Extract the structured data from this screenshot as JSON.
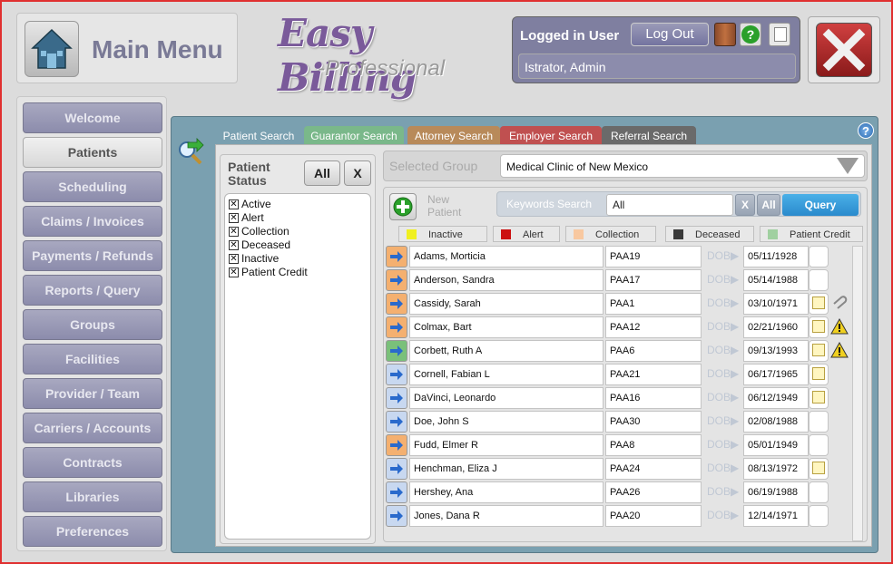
{
  "header": {
    "main_menu_label": "Main Menu",
    "logo_text": "Easy Billing",
    "logo_subtext": "-Professional",
    "logged_in_label": "Logged in User",
    "logout_label": "Log Out",
    "user_name": "Istrator, Admin"
  },
  "sidebar": {
    "items": [
      {
        "label": "Welcome"
      },
      {
        "label": "Patients"
      },
      {
        "label": "Scheduling"
      },
      {
        "label": "Claims / Invoices"
      },
      {
        "label": "Payments / Refunds"
      },
      {
        "label": "Reports / Query"
      },
      {
        "label": "Groups"
      },
      {
        "label": "Facilities"
      },
      {
        "label": "Provider / Team"
      },
      {
        "label": "Carriers / Accounts"
      },
      {
        "label": "Contracts"
      },
      {
        "label": "Libraries"
      },
      {
        "label": "Preferences"
      }
    ],
    "active": "Patients"
  },
  "tabs": [
    {
      "label": "Patient Search",
      "color": "#7aa0b0"
    },
    {
      "label": "Guarantor Search",
      "color": "#7ab88a"
    },
    {
      "label": "Attorney Search",
      "color": "#b88a5a"
    },
    {
      "label": "Employer Search",
      "color": "#c05050"
    },
    {
      "label": "Referral Search",
      "color": "#6a6a6a"
    }
  ],
  "status": {
    "title_line1": "Patient",
    "title_line2": "Status",
    "all_label": "All",
    "x_label": "X",
    "items": [
      "Active",
      "Alert",
      "Collection",
      "Deceased",
      "Inactive",
      "Patient Credit"
    ]
  },
  "group": {
    "label": "Selected Group",
    "value": "Medical Clinic of New Mexico"
  },
  "search": {
    "new_patient_line1": "New",
    "new_patient_line2": "Patient",
    "keywords_label": "Keywords Search",
    "keywords_value": "All",
    "x_label": "X",
    "all_label": "All",
    "query_label": "Query"
  },
  "legend": [
    {
      "label": "Inactive",
      "color": "#f0f020"
    },
    {
      "label": "Alert",
      "color": "#cc1010"
    },
    {
      "label": "Collection",
      "color": "#f8c8a0"
    },
    {
      "label": "Deceased",
      "color": "#3a3a3a"
    },
    {
      "label": "Patient Credit",
      "color": "#a0d0a0"
    }
  ],
  "dob_label": "DOB▶",
  "patients": [
    {
      "name": "Adams, Morticia",
      "id": "PAA19",
      "dob": "05/11/1928",
      "status": "collection",
      "note": false,
      "warn": false,
      "clip": false
    },
    {
      "name": "Anderson, Sandra",
      "id": "PAA17",
      "dob": "05/14/1988",
      "status": "collection",
      "note": false,
      "warn": false,
      "clip": false
    },
    {
      "name": "Cassidy, Sarah",
      "id": "PAA1",
      "dob": "03/10/1971",
      "status": "collection",
      "note": true,
      "warn": false,
      "clip": true
    },
    {
      "name": "Colmax, Bart",
      "id": "PAA12",
      "dob": "02/21/1960",
      "status": "collection",
      "note": true,
      "warn": true,
      "clip": false
    },
    {
      "name": "Corbett, Ruth A",
      "id": "PAA6",
      "dob": "09/13/1993",
      "status": "credit",
      "note": true,
      "warn": true,
      "clip": false
    },
    {
      "name": "Cornell, Fabian L",
      "id": "PAA21",
      "dob": "06/17/1965",
      "status": "active",
      "note": true,
      "warn": false,
      "clip": false
    },
    {
      "name": "DaVinci, Leonardo",
      "id": "PAA16",
      "dob": "06/12/1949",
      "status": "active",
      "note": true,
      "warn": false,
      "clip": false
    },
    {
      "name": "Doe, John S",
      "id": "PAA30",
      "dob": "02/08/1988",
      "status": "active",
      "note": false,
      "warn": false,
      "clip": false
    },
    {
      "name": "Fudd, Elmer R",
      "id": "PAA8",
      "dob": "05/01/1949",
      "status": "collection",
      "note": false,
      "warn": false,
      "clip": false
    },
    {
      "name": "Henchman, Eliza J",
      "id": "PAA24",
      "dob": "08/13/1972",
      "status": "active",
      "note": true,
      "warn": false,
      "clip": false
    },
    {
      "name": "Hershey, Ana",
      "id": "PAA26",
      "dob": "06/19/1988",
      "status": "active",
      "note": false,
      "warn": false,
      "clip": false
    },
    {
      "name": "Jones, Dana R",
      "id": "PAA20",
      "dob": "12/14/1971",
      "status": "active",
      "note": false,
      "warn": false,
      "clip": false
    }
  ]
}
